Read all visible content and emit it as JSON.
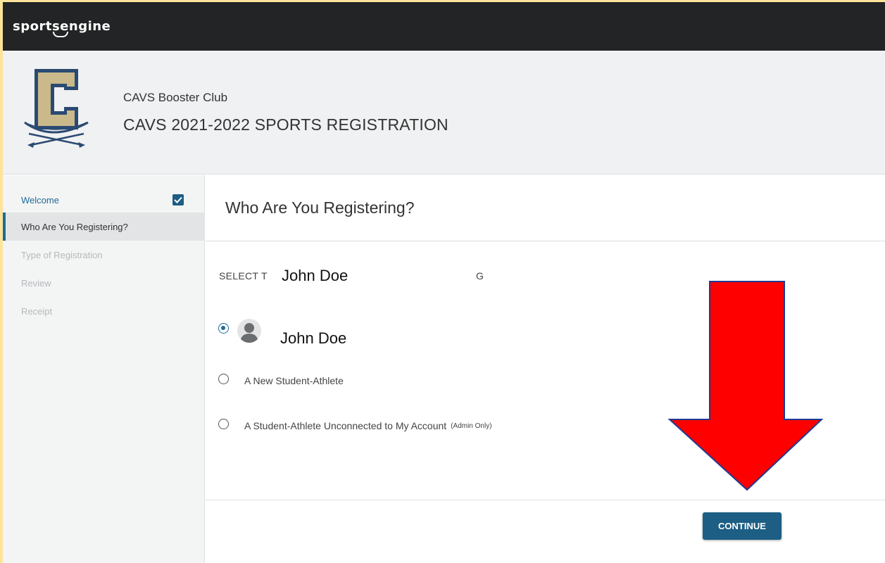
{
  "brand": {
    "left": "sport",
    "mid": "se",
    "right": "ngine"
  },
  "org": {
    "name": "CAVS Booster Club",
    "event": "CAVS 2021-2022 SPORTS REGISTRATION",
    "logo_letter": "C"
  },
  "sidebar": {
    "items": [
      {
        "label": "Welcome",
        "state": "done"
      },
      {
        "label": "Who Are You Registering?",
        "state": "active"
      },
      {
        "label": "Type of Registration",
        "state": "disabled"
      },
      {
        "label": "Review",
        "state": "disabled"
      },
      {
        "label": "Receipt",
        "state": "disabled"
      }
    ]
  },
  "main": {
    "title": "Who Are You Registering?",
    "select_label_visible": "SELECT T",
    "select_label_overlay_name": "John Doe",
    "select_label_tail": "G",
    "options": [
      {
        "label": "John Doe",
        "selected": true,
        "icon": "person-avatar-icon"
      },
      {
        "label": "A New Student-Athlete",
        "selected": false
      },
      {
        "label": "A Student-Athlete Unconnected to My Account",
        "note": "(Admin Only)",
        "selected": false
      }
    ],
    "continue_label": "CONTINUE"
  },
  "colors": {
    "accent": "#1d5e84",
    "topbar": "#222425",
    "annotation_arrow": "#ff0000",
    "outer_border": "#fde49a"
  }
}
